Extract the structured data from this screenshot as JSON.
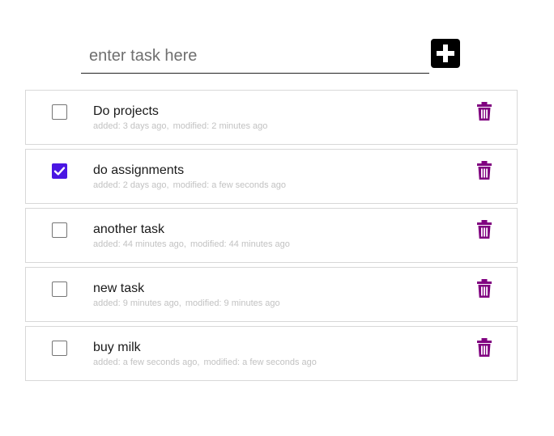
{
  "input": {
    "placeholder": "enter task here",
    "value": ""
  },
  "add_button": {
    "icon": "plus-square-icon"
  },
  "colors": {
    "checkbox_checked": "#4a16e3",
    "delete_icon": "#800080",
    "meta_text": "#c2c2c2"
  },
  "tasks": [
    {
      "title": "Do projects",
      "checked": false,
      "added": "added: 3 days ago,",
      "modified": "modified: 2 minutes ago"
    },
    {
      "title": "do assignments",
      "checked": true,
      "added": "added: 2 days ago,",
      "modified": "modified: a few seconds ago"
    },
    {
      "title": "another task",
      "checked": false,
      "added": "added: 44 minutes ago,",
      "modified": "modified: 44 minutes ago"
    },
    {
      "title": "new task",
      "checked": false,
      "added": "added: 9 minutes ago,",
      "modified": "modified: 9 minutes ago"
    },
    {
      "title": "buy milk",
      "checked": false,
      "added": "added: a few seconds ago,",
      "modified": "modified: a few seconds ago"
    }
  ]
}
